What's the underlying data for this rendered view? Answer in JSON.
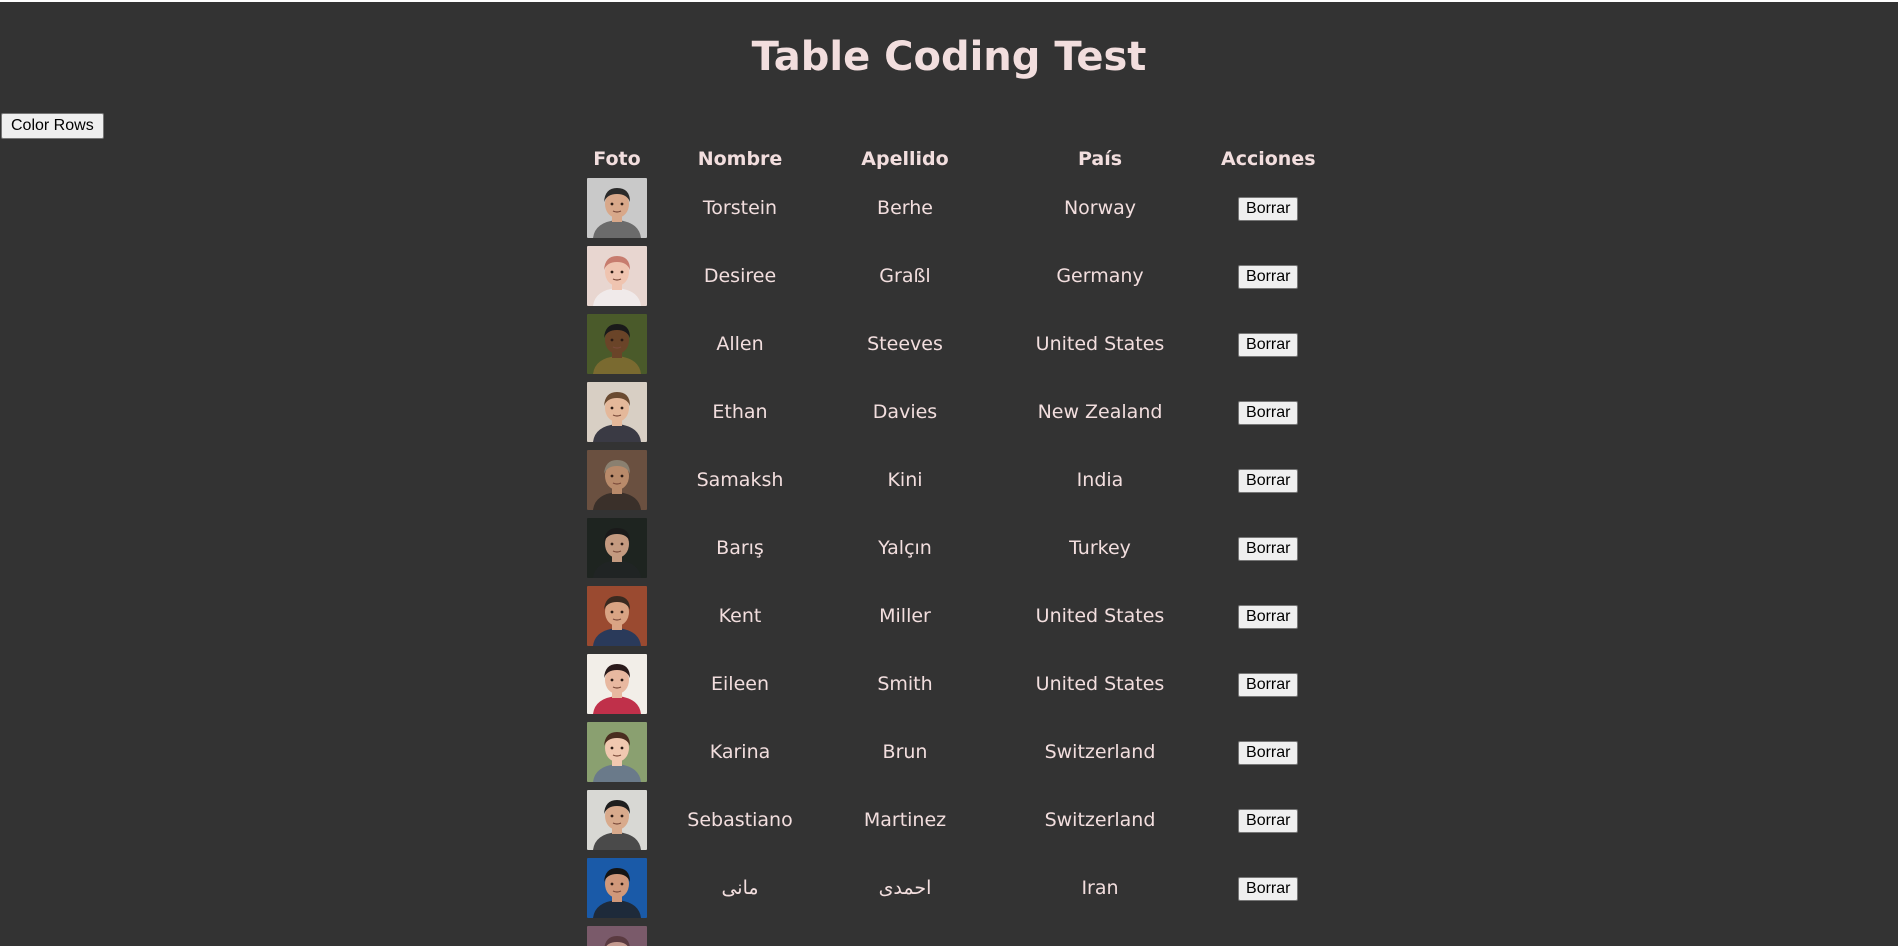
{
  "page": {
    "title": "Table Coding Test",
    "color_rows_label": "Color Rows"
  },
  "table": {
    "headers": {
      "foto": "Foto",
      "nombre": "Nombre",
      "apellido": "Apellido",
      "pais": "País",
      "acciones": "Acciones"
    },
    "rows": [
      {
        "nombre": "Torstein",
        "apellido": "Berhe",
        "pais": "Norway",
        "action": "Borrar",
        "photo": {
          "bg": "#c9c9c9",
          "skin": "#d8a88a",
          "hair": "#2a2a2a",
          "shirt": "#6b6b6b"
        }
      },
      {
        "nombre": "Desiree",
        "apellido": "Graßl",
        "pais": "Germany",
        "action": "Borrar",
        "photo": {
          "bg": "#e8d6d0",
          "skin": "#efc4b0",
          "hair": "#c77c6e",
          "shirt": "#f0eaea"
        }
      },
      {
        "nombre": "Allen",
        "apellido": "Steeves",
        "pais": "United States",
        "action": "Borrar",
        "photo": {
          "bg": "#4a5a2a",
          "skin": "#6a4428",
          "hair": "#1a1a1a",
          "shirt": "#7a6a30"
        }
      },
      {
        "nombre": "Ethan",
        "apellido": "Davies",
        "pais": "New Zealand",
        "action": "Borrar",
        "photo": {
          "bg": "#d8cfc4",
          "skin": "#e4b89a",
          "hair": "#6a4a30",
          "shirt": "#3a3a44"
        }
      },
      {
        "nombre": "Samaksh",
        "apellido": "Kini",
        "pais": "India",
        "action": "Borrar",
        "photo": {
          "bg": "#6a5040",
          "skin": "#b88a6a",
          "hair": "#8a8070",
          "shirt": "#3a302a"
        }
      },
      {
        "nombre": "Barış",
        "apellido": "Yalçın",
        "pais": "Turkey",
        "action": "Borrar",
        "photo": {
          "bg": "#1e2420",
          "skin": "#c49a80",
          "hair": "#1a1a1a",
          "shirt": "#202424"
        }
      },
      {
        "nombre": "Kent",
        "apellido": "Miller",
        "pais": "United States",
        "action": "Borrar",
        "photo": {
          "bg": "#9a4a30",
          "skin": "#d9a484",
          "hair": "#3a2a20",
          "shirt": "#2a3a5a"
        }
      },
      {
        "nombre": "Eileen",
        "apellido": "Smith",
        "pais": "United States",
        "action": "Borrar",
        "photo": {
          "bg": "#f2eee8",
          "skin": "#e8b8a0",
          "hair": "#2a1a1a",
          "shirt": "#c0304a"
        }
      },
      {
        "nombre": "Karina",
        "apellido": "Brun",
        "pais": "Switzerland",
        "action": "Borrar",
        "photo": {
          "bg": "#8aa070",
          "skin": "#f0c8b0",
          "hair": "#4a2e20",
          "shirt": "#6a7a8a"
        }
      },
      {
        "nombre": "Sebastiano",
        "apellido": "Martinez",
        "pais": "Switzerland",
        "action": "Borrar",
        "photo": {
          "bg": "#d8d8d4",
          "skin": "#d8aa8c",
          "hair": "#1e1e1e",
          "shirt": "#4a4a4a"
        }
      },
      {
        "nombre": "مانی",
        "apellido": "احمدی",
        "pais": "Iran",
        "action": "Borrar",
        "photo": {
          "bg": "#1a5aa8",
          "skin": "#d0987a",
          "hair": "#141414",
          "shirt": "#1e2a3a"
        }
      },
      {
        "nombre": "",
        "apellido": "",
        "pais": "",
        "action": "",
        "photo": {
          "bg": "#7a5a6a",
          "skin": "#c49a90",
          "hair": "#5a3a40",
          "shirt": "#5a4a50"
        }
      }
    ]
  }
}
